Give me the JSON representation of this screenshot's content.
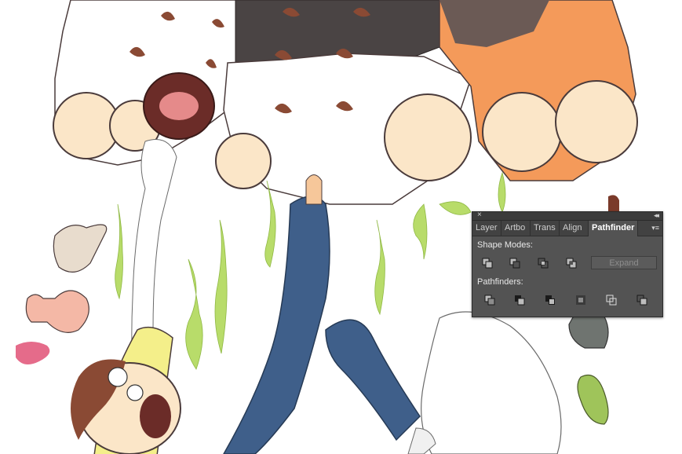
{
  "panel": {
    "close_glyph": "×",
    "collapse_glyph": "◂◂",
    "tabs": [
      {
        "label": "Layer"
      },
      {
        "label": "Artbo"
      },
      {
        "label": "Trans"
      },
      {
        "label": "Align"
      },
      {
        "label": "Pathfinder",
        "active": true
      }
    ],
    "menu_glyph": "▾≡",
    "shape_modes_label": "Shape Modes:",
    "shape_modes": [
      "unite-icon",
      "minus-front-icon",
      "intersect-icon",
      "exclude-icon"
    ],
    "expand_label": "Expand",
    "pathfinders_label": "Pathfinders:",
    "pathfinders": [
      "divide-icon",
      "trim-icon",
      "merge-icon",
      "crop-icon",
      "outline-icon",
      "minus-back-icon"
    ]
  },
  "colors": {
    "panel_bg": "#535353",
    "slime": "#b8dc6a",
    "fur_orange": "#f49a5a",
    "fur_dark": "#4a4444",
    "jeans": "#3f5f8a",
    "shirt": "#f4ef8a"
  }
}
